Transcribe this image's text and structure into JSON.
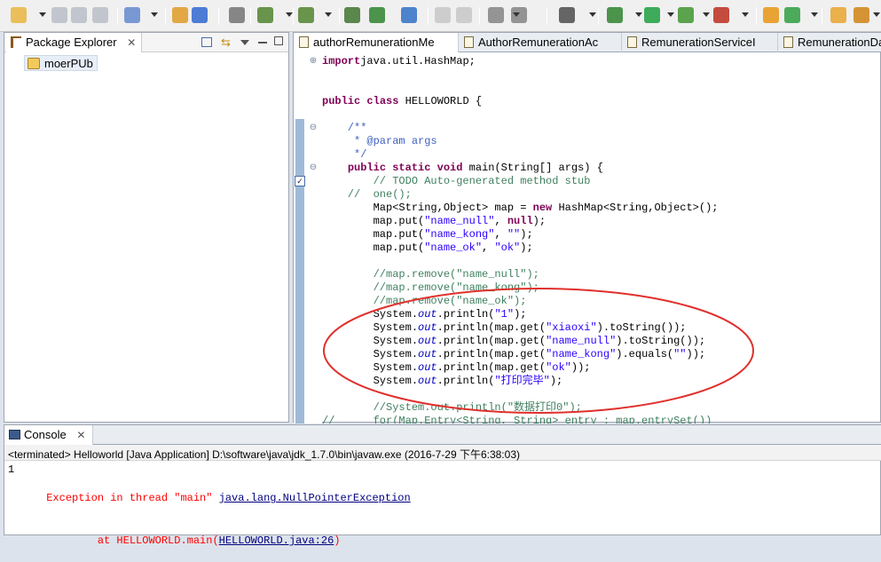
{
  "toolbar": {
    "buttons": [
      "new-icon",
      "save-icon",
      "save-all-icon",
      "print-icon",
      "new-wizard-icon",
      "package-icon",
      "class-icon",
      "server-icon",
      "open-type-icon",
      "search-icon",
      "build-icon",
      "run-icon",
      "globe-icon",
      "back-icon",
      "forward-icon",
      "task-icon",
      "web-icon",
      "screenshot-icon",
      "debug-icon",
      "run-icon",
      "coverage-icon",
      "external-tools-icon",
      "new-java-project-icon",
      "refresh-icon",
      "open-folder-icon",
      "pin-icon"
    ]
  },
  "package_explorer": {
    "title": "Package Explorer",
    "project": "moerPUb"
  },
  "editor": {
    "tabs": [
      "authorRemunerationMe",
      "AuthorRemunerationAc",
      "RemunerationServiceI",
      "RemunerationDa"
    ],
    "code": [
      {
        "segs": [
          [
            "kw",
            "import"
          ],
          [
            "",
            "java.util.HashMap;"
          ]
        ]
      },
      {
        "segs": []
      },
      {
        "segs": []
      },
      {
        "segs": [
          [
            "kw",
            "public"
          ],
          [
            "",
            " "
          ],
          [
            "kw",
            "class"
          ],
          [
            "",
            " HELLOWORLD {"
          ]
        ]
      },
      {
        "segs": []
      },
      {
        "segs": [
          [
            "jd",
            "    /**"
          ]
        ]
      },
      {
        "segs": [
          [
            "jd",
            "     * @param args"
          ]
        ]
      },
      {
        "segs": [
          [
            "jd",
            "     */"
          ]
        ]
      },
      {
        "segs": [
          [
            "",
            "    "
          ],
          [
            "kw",
            "public"
          ],
          [
            "",
            " "
          ],
          [
            "kw",
            "static"
          ],
          [
            "",
            " "
          ],
          [
            "kw",
            "void"
          ],
          [
            "",
            " main(String[] args) {"
          ]
        ]
      },
      {
        "segs": [
          [
            "cmt",
            "        // TODO Auto-generated method stub"
          ]
        ]
      },
      {
        "segs": [
          [
            "cmt",
            "    //  one();"
          ]
        ]
      },
      {
        "segs": [
          [
            "",
            "        Map<String,Object> map = "
          ],
          [
            "kw",
            "new"
          ],
          [
            "",
            " HashMap<String,Object>();"
          ]
        ]
      },
      {
        "segs": [
          [
            "",
            "        map.put("
          ],
          [
            "str",
            "\"name_null\""
          ],
          [
            "",
            ", "
          ],
          [
            "kw",
            "null"
          ],
          [
            "",
            ");"
          ]
        ]
      },
      {
        "segs": [
          [
            "",
            "        map.put("
          ],
          [
            "str",
            "\"name_kong\""
          ],
          [
            "",
            ", "
          ],
          [
            "str",
            "\"\""
          ],
          [
            "",
            ");"
          ]
        ]
      },
      {
        "segs": [
          [
            "",
            "        map.put("
          ],
          [
            "str",
            "\"name_ok\""
          ],
          [
            "",
            ", "
          ],
          [
            "str",
            "\"ok\""
          ],
          [
            "",
            ");"
          ]
        ]
      },
      {
        "segs": []
      },
      {
        "segs": [
          [
            "cmt",
            "        //map.remove(\"name_null\");"
          ]
        ]
      },
      {
        "segs": [
          [
            "cmt",
            "        //map.remove(\"name_kong\");"
          ]
        ]
      },
      {
        "segs": [
          [
            "cmt",
            "        //map.remove(\"name_ok\");"
          ]
        ]
      },
      {
        "segs": [
          [
            "",
            "        System."
          ],
          [
            "it",
            "out"
          ],
          [
            "",
            ".println("
          ],
          [
            "str",
            "\"1\""
          ],
          [
            "",
            ");"
          ]
        ]
      },
      {
        "segs": [
          [
            "",
            "        System."
          ],
          [
            "it",
            "out"
          ],
          [
            "",
            ".println(map.get("
          ],
          [
            "str",
            "\"xiaoxi\""
          ],
          [
            "",
            ").toString());"
          ]
        ]
      },
      {
        "segs": [
          [
            "",
            "        System."
          ],
          [
            "it",
            "out"
          ],
          [
            "",
            ".println(map.get("
          ],
          [
            "str",
            "\"name_null\""
          ],
          [
            "",
            ").toString());"
          ]
        ]
      },
      {
        "segs": [
          [
            "",
            "        System."
          ],
          [
            "it",
            "out"
          ],
          [
            "",
            ".println(map.get("
          ],
          [
            "str",
            "\"name_kong\""
          ],
          [
            "",
            ").equals("
          ],
          [
            "str",
            "\"\""
          ],
          [
            "",
            "));"
          ]
        ]
      },
      {
        "segs": [
          [
            "",
            "        System."
          ],
          [
            "it",
            "out"
          ],
          [
            "",
            ".println(map.get("
          ],
          [
            "str",
            "\"ok\""
          ],
          [
            "",
            "));"
          ]
        ]
      },
      {
        "segs": [
          [
            "",
            "        System."
          ],
          [
            "it",
            "out"
          ],
          [
            "",
            ".println("
          ],
          [
            "str",
            "\"打印完毕\""
          ],
          [
            "",
            ");"
          ]
        ]
      },
      {
        "segs": []
      },
      {
        "segs": [
          [
            "cmt",
            "        //System.out.println(\"数据打印0\");"
          ]
        ]
      },
      {
        "segs": [
          [
            "cmt",
            "//      for(Map.Entry<String, String> entry : map.entrySet())"
          ]
        ]
      }
    ]
  },
  "console": {
    "title": "Console",
    "header": "<terminated> Helloworld [Java Application] D:\\software\\java\\jdk_1.7.0\\bin\\javaw.exe (2016-7-29 下午6:38:03)",
    "line1": "1",
    "exception_prefix": "Exception in thread \"main\" ",
    "exception_class": "java.lang.NullPointerException",
    "at_prefix": "        at HELLOWORLD.main(",
    "at_location": "HELLOWORLD.java:26",
    "at_suffix": ")"
  },
  "colors": {
    "keyword": "#7f0055",
    "string": "#2a00ff",
    "comment": "#3f7f5f",
    "error": "#ff0000",
    "annotation_circle": "#e0302c"
  }
}
